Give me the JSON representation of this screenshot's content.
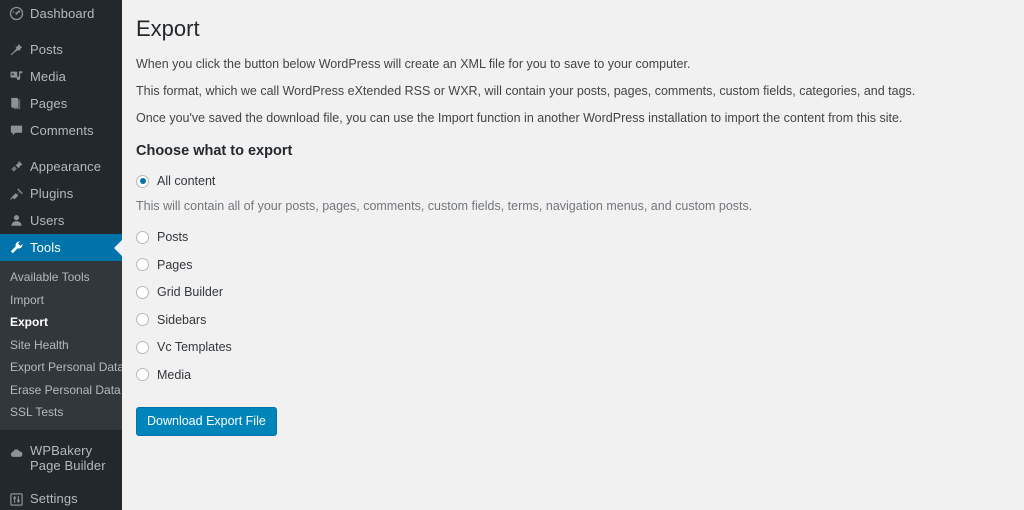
{
  "sidebar": {
    "groups": [
      {
        "items": [
          {
            "label": "Dashboard",
            "icon": "dashboard-icon",
            "current": false
          }
        ]
      },
      {
        "items": [
          {
            "label": "Posts",
            "icon": "pin-icon",
            "current": false
          },
          {
            "label": "Media",
            "icon": "media-icon",
            "current": false
          },
          {
            "label": "Pages",
            "icon": "pages-icon",
            "current": false
          },
          {
            "label": "Comments",
            "icon": "comments-icon",
            "current": false
          }
        ]
      },
      {
        "items": [
          {
            "label": "Appearance",
            "icon": "appearance-brush-icon",
            "current": false
          },
          {
            "label": "Plugins",
            "icon": "plugins-plug-icon",
            "current": false
          },
          {
            "label": "Users",
            "icon": "users-icon",
            "current": false
          },
          {
            "label": "Tools",
            "icon": "tools-wrench-icon",
            "current": true
          }
        ]
      }
    ],
    "submenu": {
      "items": [
        {
          "label": "Available Tools",
          "current": false
        },
        {
          "label": "Import",
          "current": false
        },
        {
          "label": "Export",
          "current": true
        },
        {
          "label": "Site Health",
          "current": false
        },
        {
          "label": "Export Personal Data",
          "current": false
        },
        {
          "label": "Erase Personal Data",
          "current": false
        },
        {
          "label": "SSL Tests",
          "current": false
        }
      ]
    },
    "bottom_groups": [
      {
        "items": [
          {
            "label": "WPBakery Page Builder",
            "icon": "wpbakery-cloud-icon",
            "current": false,
            "multiline": true
          }
        ]
      },
      {
        "items": [
          {
            "label": "Settings",
            "icon": "settings-sliders-icon",
            "current": false
          }
        ]
      }
    ]
  },
  "main": {
    "title": "Export",
    "intro_paragraphs": [
      "When you click the button below WordPress will create an XML file for you to save to your computer.",
      "This format, which we call WordPress eXtended RSS or WXR, will contain your posts, pages, comments, custom fields, categories, and tags.",
      "Once you've saved the download file, you can use the Import function in another WordPress installation to import the content from this site."
    ],
    "section_title": "Choose what to export",
    "all_content": {
      "label": "All content",
      "checked": true,
      "description": "This will contain all of your posts, pages, comments, custom fields, terms, navigation menus, and custom posts."
    },
    "options": [
      {
        "label": "Posts",
        "checked": false
      },
      {
        "label": "Pages",
        "checked": false
      },
      {
        "label": "Grid Builder",
        "checked": false
      },
      {
        "label": "Sidebars",
        "checked": false
      },
      {
        "label": "Vc Templates",
        "checked": false
      },
      {
        "label": "Media",
        "checked": false
      }
    ],
    "download_button": "Download Export File"
  },
  "colors": {
    "sidebar_bg": "#23282d",
    "submenu_bg": "#32373c",
    "accent_blue": "#0073aa",
    "button_blue": "#0085ba",
    "content_bg": "#f1f1f1"
  }
}
